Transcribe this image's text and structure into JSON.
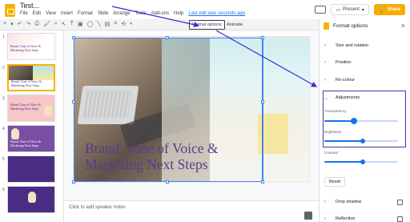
{
  "app": {
    "doc_title": "Test...",
    "menu": [
      "File",
      "Edit",
      "View",
      "Insert",
      "Format",
      "Slide",
      "Arrange",
      "Tools",
      "Add-ons",
      "Help"
    ],
    "last_edit": "Last edit was seconds ago",
    "present_label": "Present",
    "share_label": "Share",
    "brand_color": "#f4b400"
  },
  "toolbar": {
    "format_options_label": "Format options",
    "animate_label": "Animate"
  },
  "filmstrip": {
    "slides": [
      {
        "number": "1",
        "text": "Brand, Tone of Voice & Marketing Next Steps"
      },
      {
        "number": "2",
        "text": "Brand, Tone of Voice & Marketing Next Steps"
      },
      {
        "number": "3",
        "text": "Brand, Tone of Voice & Marketing Next Steps"
      },
      {
        "number": "4",
        "text": "Brand, Tone of Voice & Marketing Next Steps"
      },
      {
        "number": "5",
        "text": ""
      },
      {
        "number": "6",
        "text": ""
      }
    ],
    "selected_index": 1
  },
  "slide": {
    "title": "Brand, Tone of Voice & Marketing Next Steps",
    "title_line1": "Brand, Tone of Voice &",
    "title_line2": "Marketing Next Steps",
    "title_color": "#5b3a8f"
  },
  "notes": {
    "placeholder": "Click to add speaker notes"
  },
  "panel": {
    "title": "Format options",
    "sections": {
      "size_rotation": "Size and rotation",
      "position": "Position",
      "recolour": "Re-colour",
      "adjustments": "Adjustments",
      "drop_shadow": "Drop shadow",
      "reflection": "Reflection"
    },
    "adjustments": {
      "transparency_label": "Transparency",
      "transparency_value": 0.4,
      "brightness_label": "Brightness",
      "brightness_value": 0.52,
      "contrast_label": "Contrast",
      "contrast_value": 0.52
    },
    "reset_label": "Reset"
  }
}
